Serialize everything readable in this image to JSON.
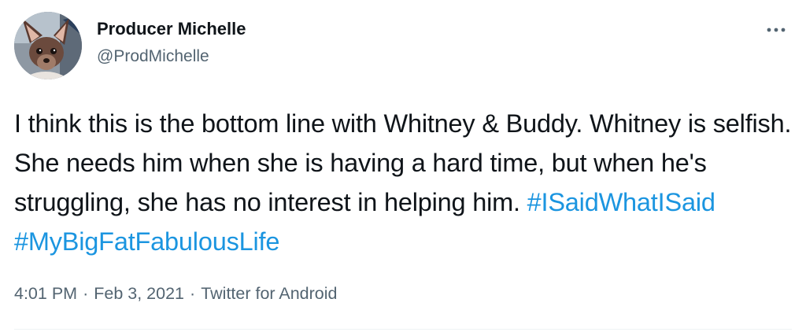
{
  "author": {
    "display_name": "Producer Michelle",
    "handle": "@ProdMichelle",
    "avatar_icon": "chihuahua-avatar"
  },
  "tweet": {
    "text_before": "I think this is the bottom line with Whitney & Buddy. Whitney is selfish. She needs him when she is having a hard time, but when he's struggling, she has no interest in helping him. ",
    "hashtags": [
      "#ISaidWhatISaid",
      "#MyBigFatFabulousLife"
    ],
    "hashtag_color": "#1b95e0"
  },
  "meta": {
    "time": "4:01 PM",
    "date": "Feb 3, 2021",
    "source": "Twitter for Android",
    "separator": "·"
  },
  "menu": {
    "icon": "more-horizontal-icon"
  }
}
